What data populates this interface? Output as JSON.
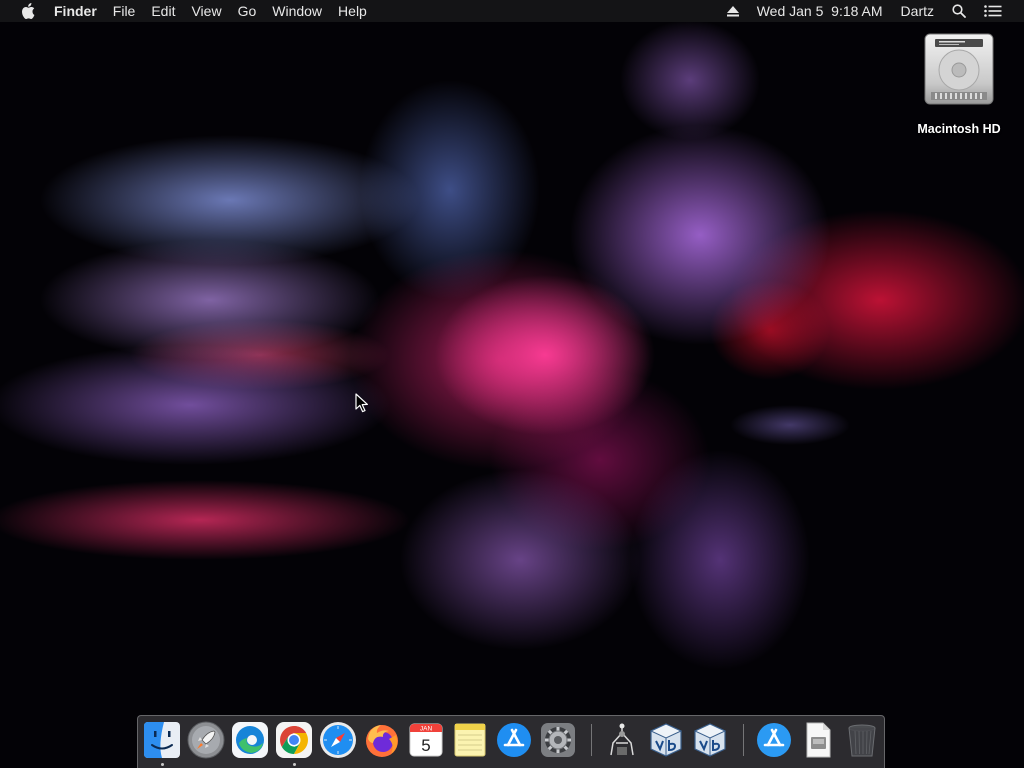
{
  "menubar": {
    "apple_icon": "apple-logo-icon",
    "app_name": "Finder",
    "menus": [
      "File",
      "Edit",
      "View",
      "Go",
      "Window",
      "Help"
    ],
    "status": {
      "eject_icon": "eject-icon",
      "clock": "Wed Jan 5  9:18 AM",
      "user": "Dartz",
      "spotlight_icon": "search-icon",
      "notification_icon": "list-icon"
    }
  },
  "desktop": {
    "icons": [
      {
        "label": "Macintosh HD",
        "icon": "hard-drive-icon"
      }
    ]
  },
  "dock": {
    "apps": [
      {
        "name": "Finder",
        "icon": "finder-icon",
        "running": true
      },
      {
        "name": "Launchpad",
        "icon": "rocket-icon",
        "running": false
      },
      {
        "name": "Microsoft Edge",
        "icon": "edge-icon",
        "running": false
      },
      {
        "name": "Google Chrome",
        "icon": "chrome-icon",
        "running": true
      },
      {
        "name": "Safari",
        "icon": "compass-icon",
        "running": false
      },
      {
        "name": "Firefox",
        "icon": "firefox-icon",
        "running": false
      },
      {
        "name": "Calendar",
        "icon": "calendar-icon",
        "running": false,
        "month": "JAN",
        "day": "5"
      },
      {
        "name": "Notes",
        "icon": "notes-icon",
        "running": false
      },
      {
        "name": "App Store",
        "icon": "app-store-icon",
        "running": false
      },
      {
        "name": "System Preferences",
        "icon": "gear-icon",
        "running": false
      },
      {
        "name": "Automator",
        "icon": "automator-icon",
        "running": false
      },
      {
        "name": "VirtualBox",
        "icon": "virtualbox-icon",
        "running": false
      },
      {
        "name": "VirtualBox VM",
        "icon": "virtualbox-vm-icon",
        "running": false
      }
    ],
    "others": [
      {
        "name": "App Store Downloads",
        "icon": "app-store-folder-icon"
      },
      {
        "name": "Document",
        "icon": "document-icon"
      },
      {
        "name": "Trash",
        "icon": "trash-icon"
      }
    ]
  },
  "colors": {
    "menubar_bg": "#161618",
    "accent_blue": "#1f8ef1"
  }
}
